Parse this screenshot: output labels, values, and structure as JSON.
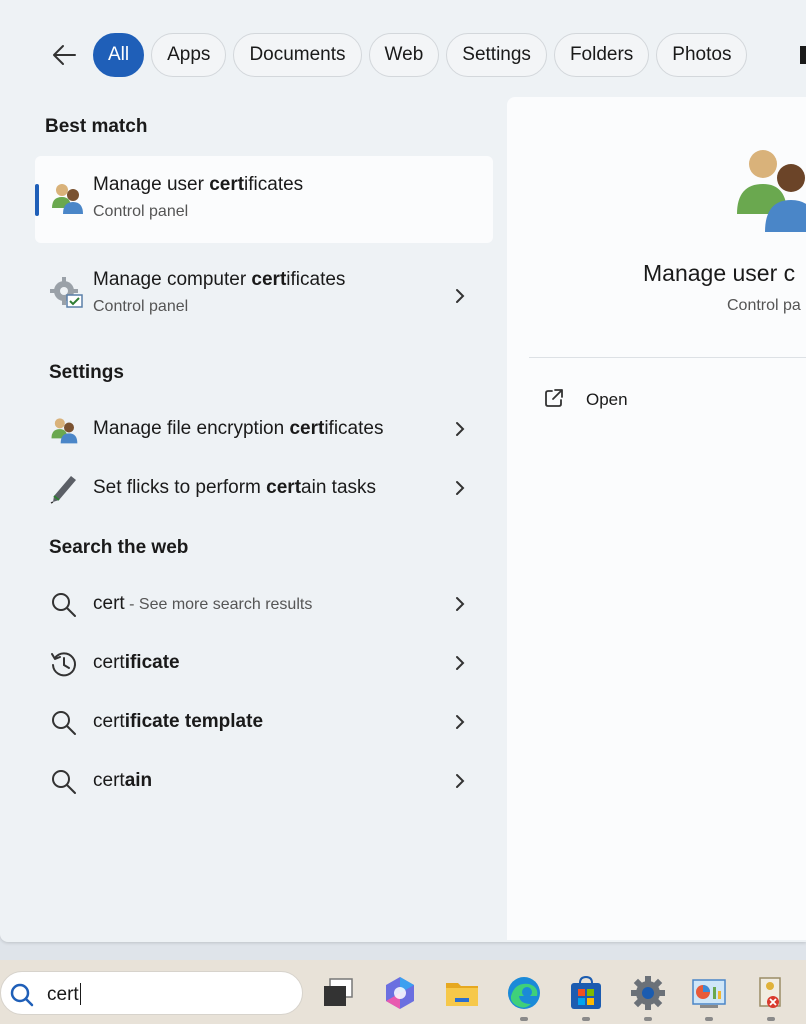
{
  "filters": {
    "back_label": "Back",
    "tabs": [
      {
        "label": "All",
        "active": true
      },
      {
        "label": "Apps"
      },
      {
        "label": "Documents"
      },
      {
        "label": "Web"
      },
      {
        "label": "Settings"
      },
      {
        "label": "Folders"
      },
      {
        "label": "Photos"
      }
    ]
  },
  "best_match": {
    "title": "Best match",
    "items": [
      {
        "name_pre": "Manage user ",
        "name_bold": "cert",
        "name_post": "ificates",
        "sub": "Control panel",
        "icon": "users-icon"
      },
      {
        "name_pre": "Manage computer ",
        "name_bold": "cert",
        "name_post": "ificates",
        "sub": "Control panel",
        "icon": "cert-gear-icon"
      }
    ]
  },
  "settings": {
    "title": "Settings",
    "items": [
      {
        "name_pre": "Manage file encryption ",
        "name_bold": "cert",
        "name_post": "ificates",
        "icon": "users-icon"
      },
      {
        "name_pre": "Set flicks to perform ",
        "name_bold": "cert",
        "name_post": "ain tasks",
        "icon": "pen-icon"
      }
    ]
  },
  "web": {
    "title": "Search the web",
    "items": [
      {
        "pre": "cert",
        "bold": "",
        "hint": " - See more search results",
        "icon": "search-icon"
      },
      {
        "pre": "cert",
        "bold": "ificate",
        "hint": "",
        "icon": "history-icon"
      },
      {
        "pre": "cert",
        "bold": "ificate template",
        "hint": "",
        "icon": "search-icon"
      },
      {
        "pre": "cert",
        "bold": "ain",
        "hint": "",
        "icon": "search-icon"
      }
    ]
  },
  "preview": {
    "title": "Manage user c",
    "sub": "Control pa",
    "open_label": "Open"
  },
  "taskbar": {
    "search_value": "cert",
    "icons": [
      "task-view-icon",
      "copilot-icon",
      "file-explorer-icon",
      "edge-icon",
      "store-icon",
      "settings-gear-icon",
      "control-panel-icon",
      "certificate-app-icon"
    ]
  },
  "colors": {
    "accent": "#1f5fb8",
    "panel_bg": "#eef2f5",
    "taskbar_bg": "#e8e2d8"
  }
}
